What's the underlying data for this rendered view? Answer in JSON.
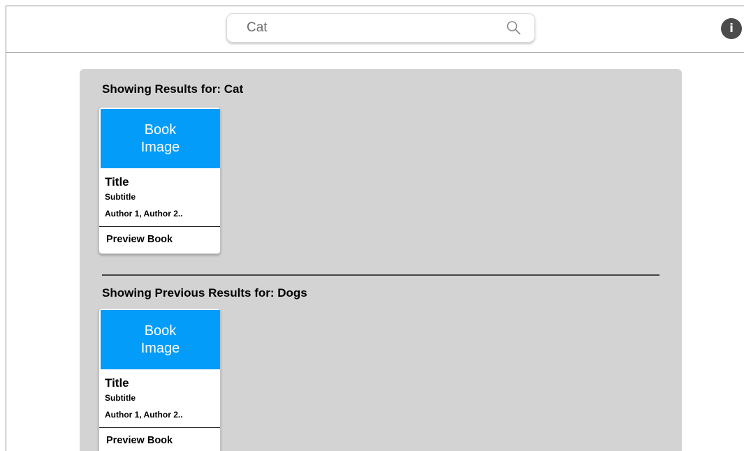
{
  "search": {
    "value": "Cat",
    "icon": "search-icon"
  },
  "header": {
    "info_label": "i",
    "info_icon": "info-icon"
  },
  "sections": [
    {
      "heading": "Showing Results for: Cat",
      "books": [
        {
          "image_label_line1": "Book",
          "image_label_line2": "Image",
          "title": "Title",
          "subtitle": "Subtitle",
          "authors": "Author 1, Author 2..",
          "preview_label": "Preview Book"
        }
      ]
    },
    {
      "heading": "Showing Previous Results for: Dogs",
      "books": [
        {
          "image_label_line1": "Book",
          "image_label_line2": "Image",
          "title": "Title",
          "subtitle": "Subtitle",
          "authors": "Author 1, Author 2..",
          "preview_label": "Preview Book"
        }
      ]
    }
  ],
  "colors": {
    "panel_background": "#d3d3d3",
    "book_image": "#049cf9",
    "info_button": "#4b4b4b"
  }
}
